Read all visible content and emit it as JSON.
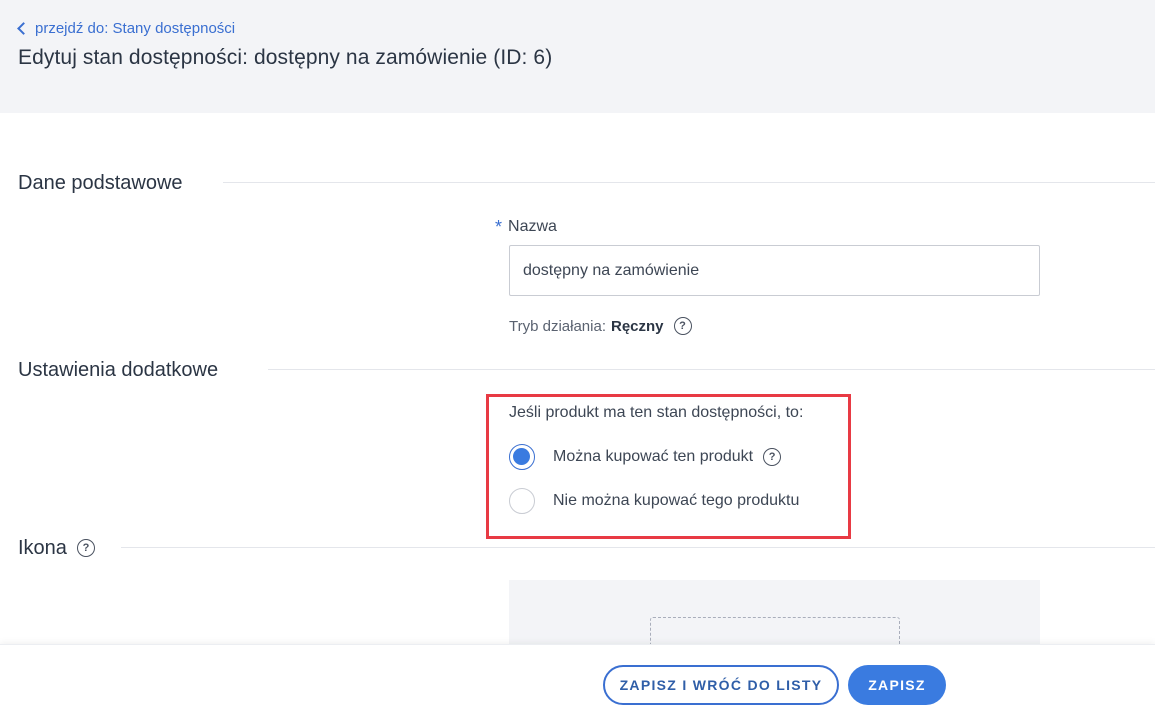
{
  "header": {
    "back_link": "przejdź do: Stany dostępności",
    "title": "Edytuj stan dostępności: dostępny na zamówienie (ID: 6)"
  },
  "basic": {
    "section_title": "Dane podstawowe",
    "name_label": "Nazwa",
    "required_mark": "*",
    "name_value": "dostępny na zamówienie",
    "mode_label": "Tryb działania:",
    "mode_value": "Ręczny"
  },
  "additional": {
    "section_title": "Ustawienia dodatkowe",
    "question": "Jeśli produkt ma ten stan dostępności, to:",
    "options": [
      {
        "label": "Można kupować ten produkt",
        "checked": true
      },
      {
        "label": "Nie można kupować tego produktu",
        "checked": false
      }
    ]
  },
  "icon_section": {
    "section_title": "Ikona"
  },
  "footer": {
    "save_and_back": "ZAPISZ I WRÓĆ DO LISTY",
    "save": "ZAPISZ"
  },
  "colors": {
    "accent": "#3a7be0",
    "highlight": "#e83a44",
    "header_bg": "#f3f4f7"
  }
}
